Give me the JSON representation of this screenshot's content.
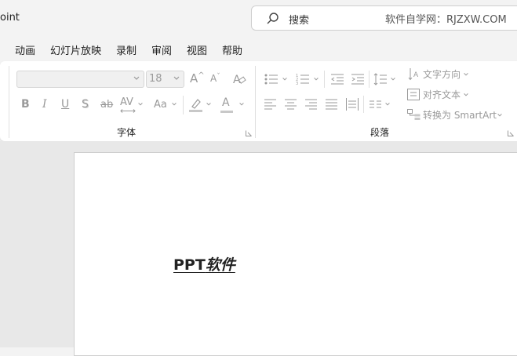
{
  "window": {
    "title": "oint"
  },
  "search": {
    "placeholder": "搜索",
    "watermark": "软件自学网：RJZXW.COM"
  },
  "menu": [
    "动画",
    "幻灯片放映",
    "录制",
    "审阅",
    "视图",
    "帮助"
  ],
  "ribbon": {
    "font_group": {
      "label": "字体",
      "font_name": "",
      "font_size": "18",
      "increase_font": "A",
      "decrease_font": "A",
      "bold": "B",
      "italic": "I",
      "underline": "U",
      "shadow": "S",
      "strikethrough": "ab",
      "char_spacing": "AV",
      "change_case": "Aa",
      "font_color": "A"
    },
    "paragraph_group": {
      "label": "段落",
      "text_direction": "文字方向",
      "align_text": "对齐文本",
      "convert_smartart": "转换为 SmartArt"
    }
  },
  "slide": {
    "text_main": "PPT",
    "text_italic": "软件"
  },
  "colors": {
    "highlight": "#c8c8c8",
    "font_color_bar": "#c8c8c8",
    "accent": "#9a9a9a"
  }
}
